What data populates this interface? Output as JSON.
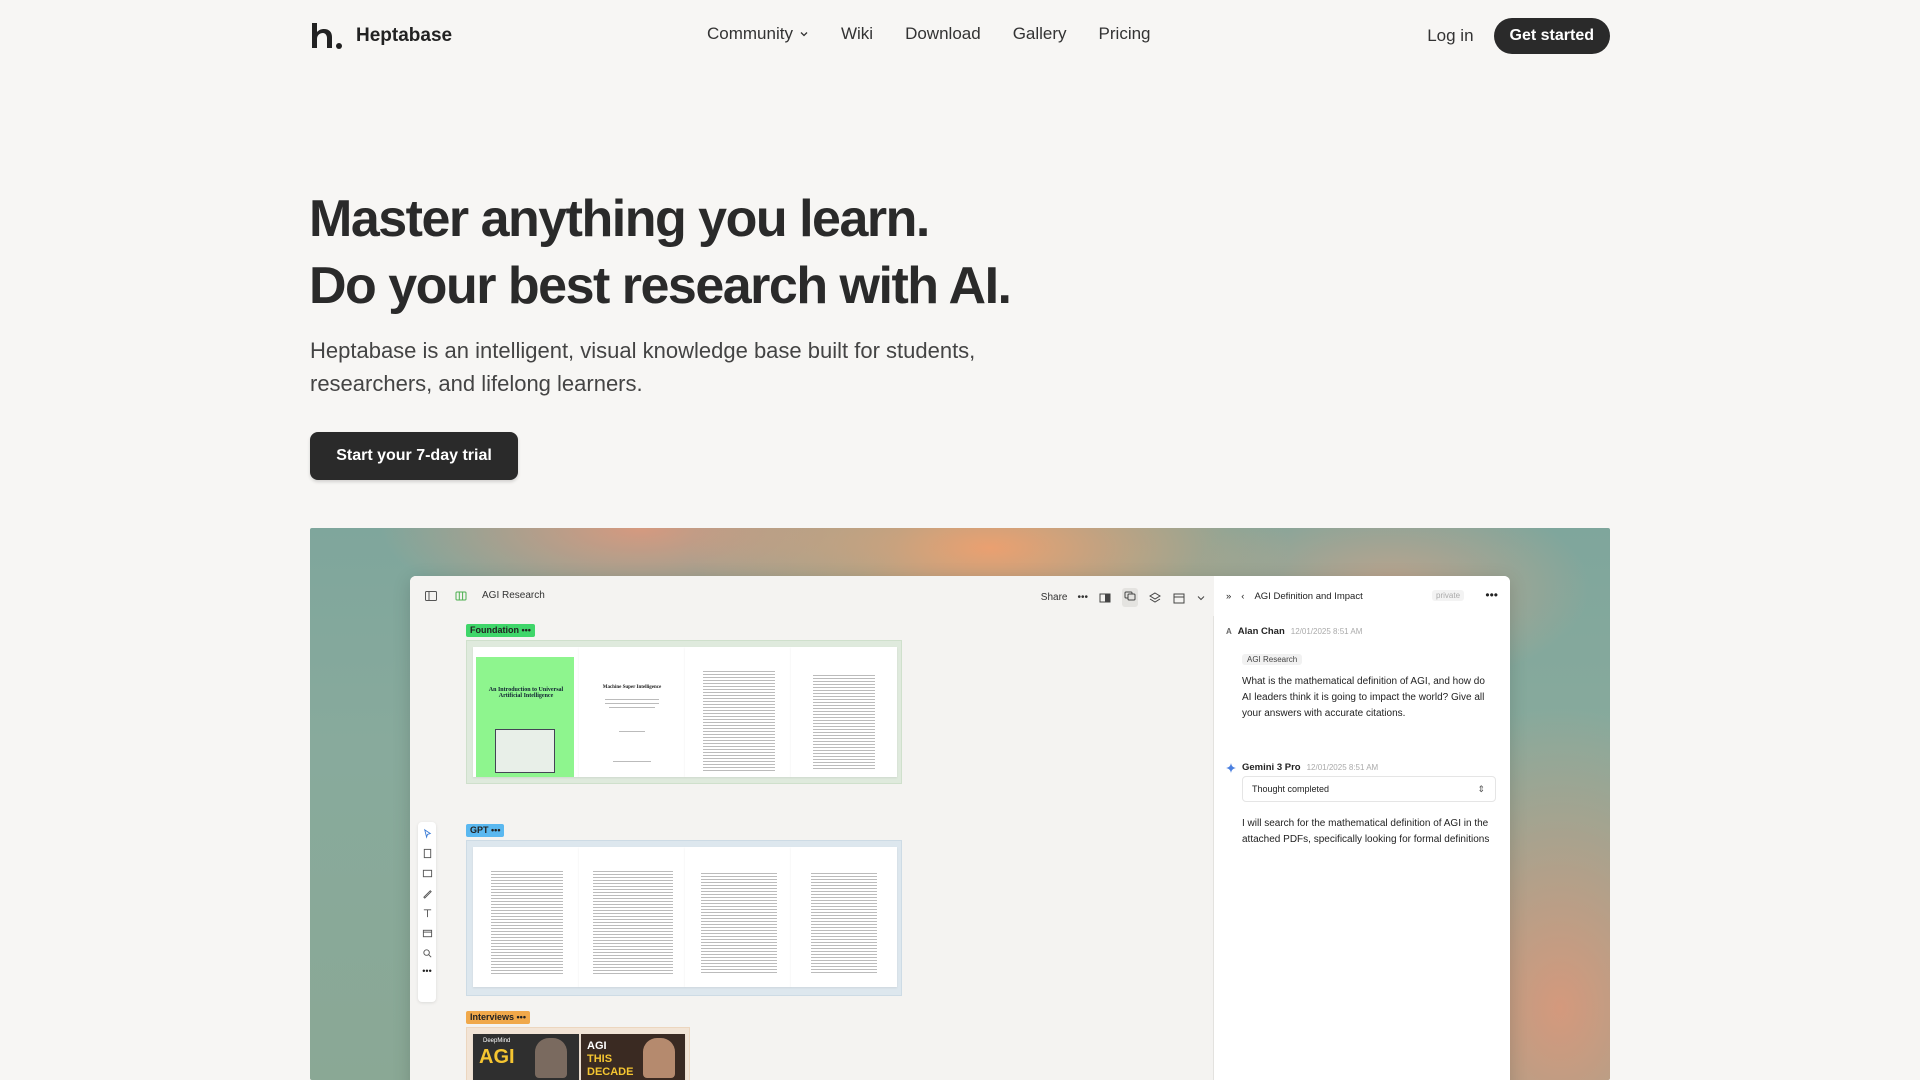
{
  "brand": {
    "name": "Heptabase"
  },
  "nav": {
    "links": [
      {
        "label": "Community",
        "has_dropdown": true
      },
      {
        "label": "Wiki"
      },
      {
        "label": "Download"
      },
      {
        "label": "Gallery"
      },
      {
        "label": "Pricing"
      }
    ],
    "login_label": "Log in",
    "get_started_label": "Get started"
  },
  "hero": {
    "title_line1": "Master anything you learn.",
    "title_line2": "Do your best research with AI.",
    "subtitle": "Heptabase is an intelligent, visual knowledge base built for students, researchers, and lifelong learners.",
    "cta_label": "Start your 7-day trial"
  },
  "app": {
    "workspace_title": "AGI Research",
    "share_label": "Share",
    "groups": [
      {
        "label": "Foundation",
        "color": "#3fd66a"
      },
      {
        "label": "GPT",
        "color": "#5ab8f0"
      },
      {
        "label": "Interviews",
        "color": "#f0a84a"
      }
    ],
    "paper1": {
      "title": "An Introduction to Universal Artificial Intelligence",
      "title2": "Machine Super Intelligence"
    },
    "video_overlay": {
      "brand": "DeepMind",
      "left_text": "AGI",
      "right_text_1": "AGI",
      "right_text_2": "THIS",
      "right_text_3": "DECADE"
    },
    "chat": {
      "title": "AGI Definition and Impact",
      "private_label": "private",
      "user": {
        "initial": "A",
        "name": "Alan Chan",
        "time": "12/01/2025 8:51 AM"
      },
      "context_chip": "AGI Research",
      "question": "What is the mathematical definition of AGI, and how do AI leaders think it is going to impact the world? Give all your answers with accurate citations.",
      "model": {
        "name": "Gemini 3 Pro",
        "time": "12/01/2025 8:51 AM"
      },
      "thought_label": "Thought completed",
      "answer": "I will search for the mathematical definition of AGI in the attached PDFs, specifically looking for formal definitions"
    }
  },
  "colors": {
    "accent_dark": "#2a2a2a",
    "background": "#f7f6f4"
  }
}
